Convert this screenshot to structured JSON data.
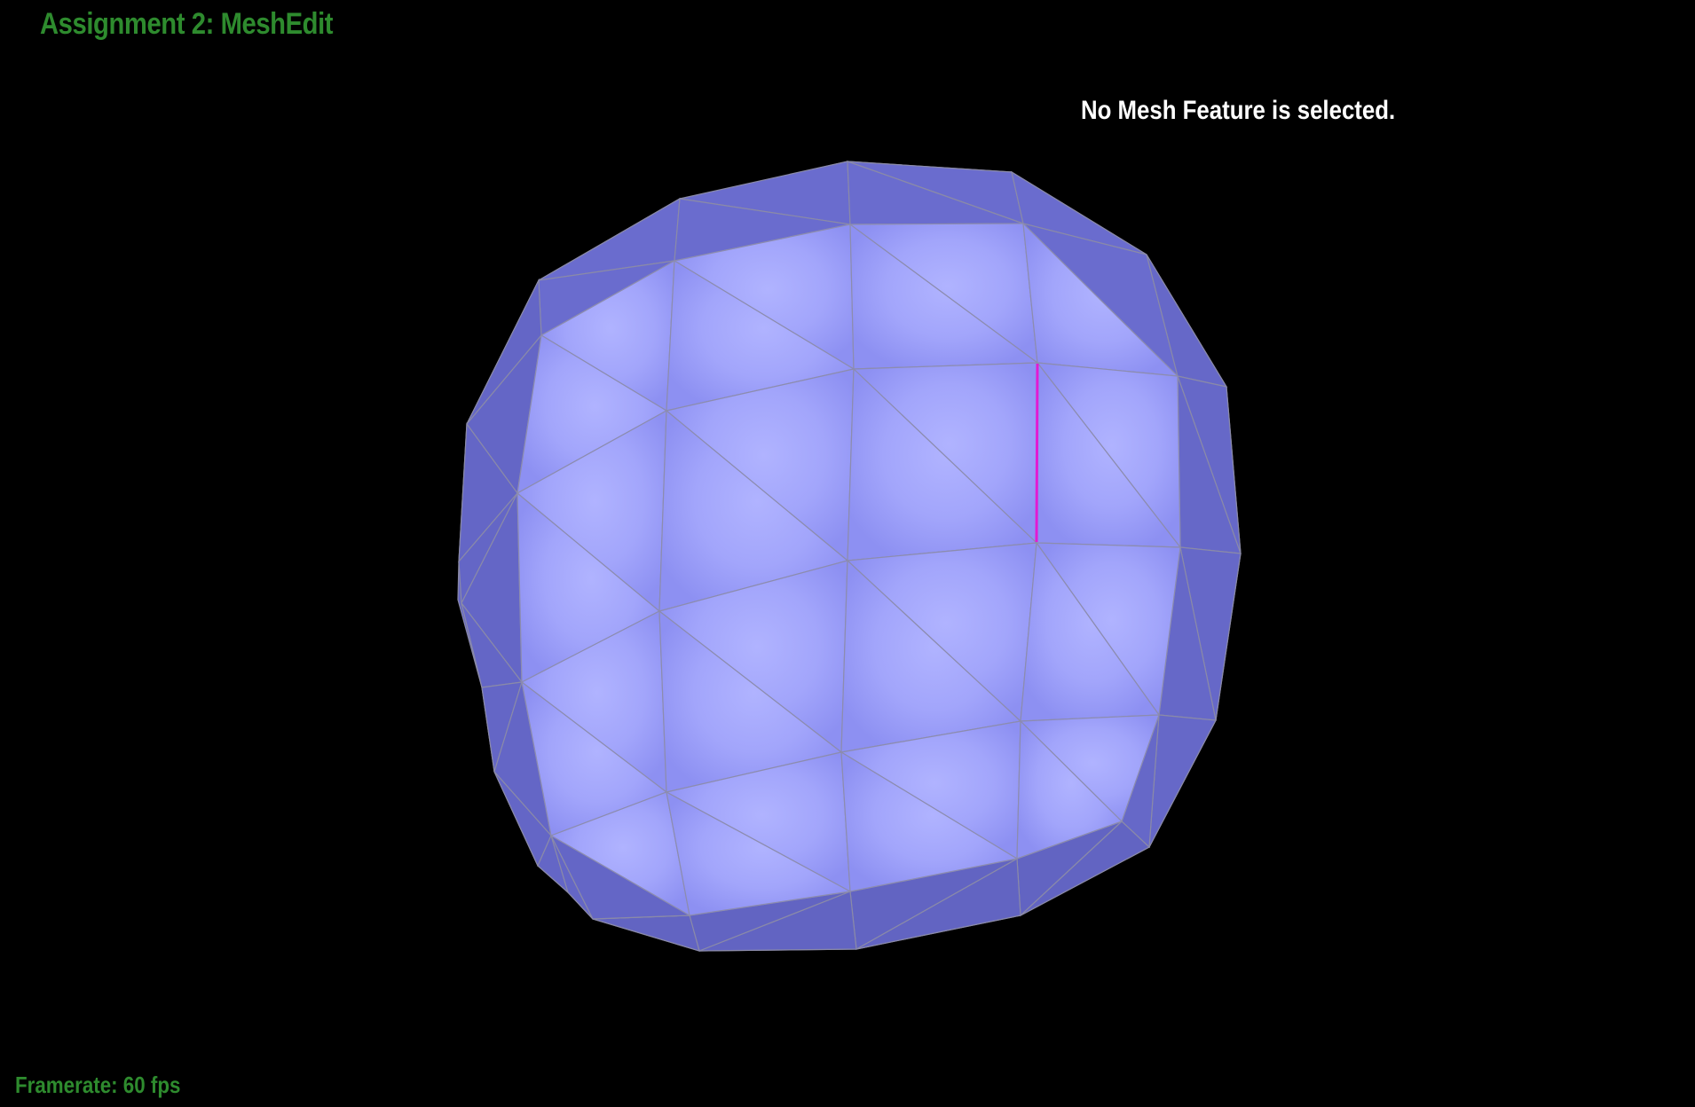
{
  "app": {
    "title": "Assignment 2: MeshEdit"
  },
  "hud": {
    "selection_status": "No Mesh Feature is selected.",
    "framerate_label": "Framerate: 60 fps"
  },
  "colors": {
    "background": "#000000",
    "title_text": "#2e8b2e",
    "status_text": "#ffffff",
    "mesh_face_front": "#a4a8ff",
    "mesh_face_side": "#6a6ccc",
    "mesh_edge": "#8a8aa8",
    "hovered_edge": "#e21bd2"
  }
}
